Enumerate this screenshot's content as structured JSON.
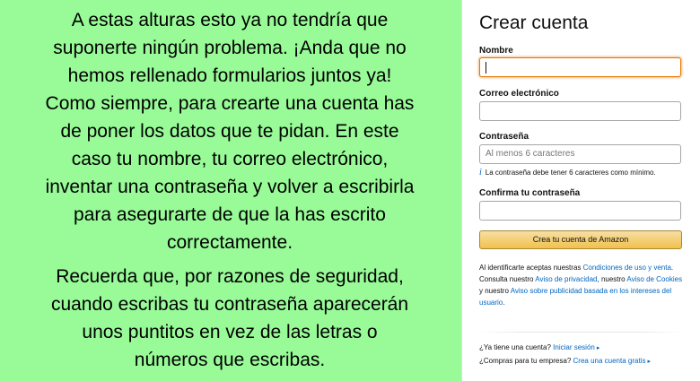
{
  "instructions": {
    "paragraph1_lines": [
      "A estas alturas esto ya no tendría que",
      "suponerte ningún problema. ¡Anda que no",
      "hemos rellenado formularios juntos ya!",
      "Como siempre, para crearte una cuenta has",
      "de poner los datos que te pidan. En este",
      "caso tu nombre, tu correo electrónico,",
      "inventar una contraseña y volver a escribirla",
      "para asegurarte de que la has escrito",
      "correctamente."
    ],
    "paragraph2_lines": [
      "Recuerda que, por razones de seguridad,",
      "cuando escribas tu contraseña aparecerán",
      "unos puntitos en vez de las letras o",
      "números que escribas."
    ]
  },
  "form": {
    "title": "Crear cuenta",
    "name_label": "Nombre",
    "email_label": "Correo electrónico",
    "password_label": "Contraseña",
    "password_placeholder": "Al menos 6 caracteres",
    "password_hint": "La contraseña debe tener 6 caracteres como mínimo.",
    "confirm_label": "Confirma tu contraseña",
    "submit_label": "Crea tu cuenta de Amazon",
    "legal": {
      "t1": "Al identificarte aceptas nuestras ",
      "l1": "Condiciones de uso y venta",
      "t2": ". Consulta nuestro ",
      "l2": "Aviso de privacidad",
      "t3": ", nuestro ",
      "l3": "Aviso de Cookies",
      "t4": " y nuestro ",
      "l4": "Aviso sobre publicidad basada en los intereses del usuario",
      "t5": "."
    },
    "signin_question": "¿Ya tiene una cuenta?",
    "signin_link": "Iniciar sesión",
    "business_question": "¿Compras para tu empresa?",
    "business_link": "Crea una cuenta gratis"
  }
}
